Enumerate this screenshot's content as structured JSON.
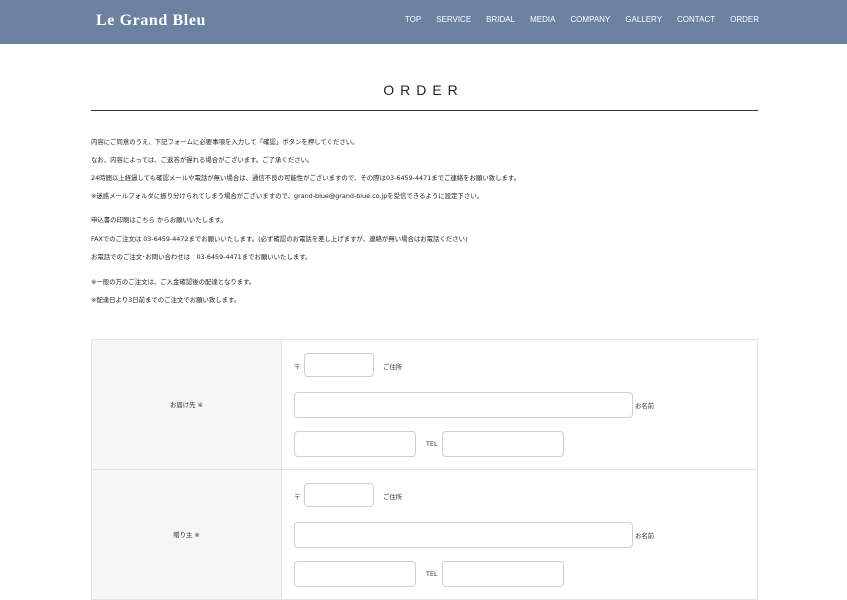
{
  "header": {
    "logo": "Le Grand Bleu",
    "nav": [
      "TOP",
      "SERVICE",
      "BRIDAL",
      "MEDIA",
      "COMPANY",
      "GALLERY",
      "CONTACT",
      "ORDER"
    ]
  },
  "page": {
    "title": "ORDER"
  },
  "notices": [
    "内容にご同意のうえ、下記フォームに必要事項を入力して「確認」ボタンを押してください。",
    "なお、内容によっては、ご返答が遅れる場合がございます。ご了承ください。",
    "24時間以上経過しても確認メールや電話が無い場合は、通信不良の可能性がございますので、その際は03-6459-4471までご連絡をお願い致します。",
    "※迷惑メールフォルダに振り分けられてしまう場合がございますので、grand-blue@grand-blue.co.jpを受信できるように設定下さい。",
    "申込書の印刷はこちら からお願いいたします。",
    "FAXでのご注文は 03-6459-4472までお願いいたします。(必ず確認のお電話を差し上げますが、連絡が無い場合はお電話ください)",
    "お電話でのご注文･お問い合わせは　03-6459-4471までお願いいたします。",
    "※一般の方のご注文は、ご入金確認後の配達となります。",
    "※配達日より3日前までのご注文でお願い致します。"
  ],
  "form": {
    "rows": [
      {
        "label": "お届け先 ※",
        "postal_mark": "〒",
        "address_label": "ご住所",
        "name_label": "お名前",
        "tel_label": "TEL"
      },
      {
        "label": "贈り主 ※",
        "postal_mark": "〒",
        "address_label": "ご住所",
        "name_label": "お名前",
        "tel_label": "TEL"
      }
    ]
  }
}
